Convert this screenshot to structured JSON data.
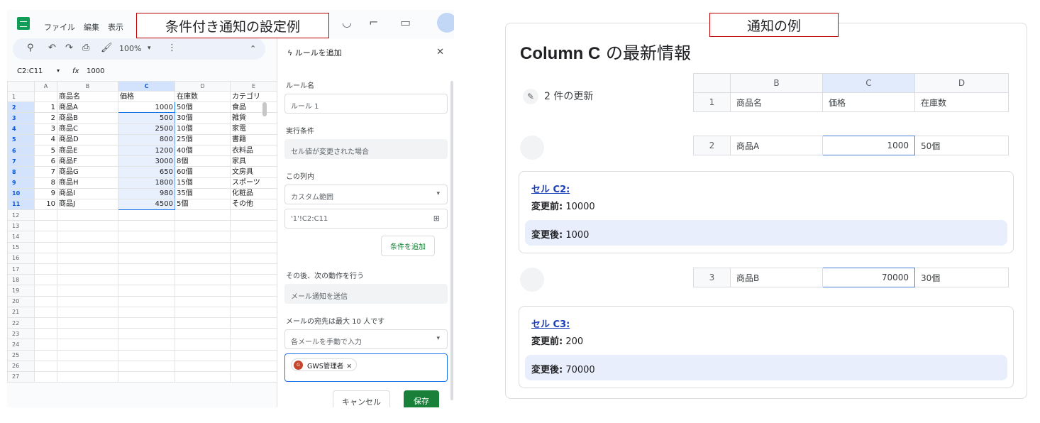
{
  "sheet": {
    "menu": [
      "ファイル",
      "編集",
      "表示"
    ],
    "callout": "条件付き通知の設定例",
    "toolbar": {
      "zoom": "100%"
    },
    "name_box": "C2:C11",
    "formula_icon": "fx",
    "formula_value": "1000",
    "columns": [
      "A",
      "B",
      "C",
      "D",
      "E"
    ],
    "selected_column": "C",
    "rows": [
      {
        "n": "1",
        "a": "",
        "b": "商品名",
        "c": "価格",
        "d": "在庫数",
        "e": "カテゴリ"
      },
      {
        "n": "2",
        "a": "1",
        "b": "商品A",
        "c": "1000",
        "d": "50個",
        "e": "食品"
      },
      {
        "n": "3",
        "a": "2",
        "b": "商品B",
        "c": "500",
        "d": "30個",
        "e": "雑貨"
      },
      {
        "n": "4",
        "a": "3",
        "b": "商品C",
        "c": "2500",
        "d": "10個",
        "e": "家電"
      },
      {
        "n": "5",
        "a": "4",
        "b": "商品D",
        "c": "800",
        "d": "25個",
        "e": "書籍"
      },
      {
        "n": "6",
        "a": "5",
        "b": "商品E",
        "c": "1200",
        "d": "40個",
        "e": "衣料品"
      },
      {
        "n": "7",
        "a": "6",
        "b": "商品F",
        "c": "3000",
        "d": "8個",
        "e": "家具"
      },
      {
        "n": "8",
        "a": "7",
        "b": "商品G",
        "c": "650",
        "d": "60個",
        "e": "文房具"
      },
      {
        "n": "9",
        "a": "8",
        "b": "商品H",
        "c": "1800",
        "d": "15個",
        "e": "スポーツ"
      },
      {
        "n": "10",
        "a": "9",
        "b": "商品I",
        "c": "980",
        "d": "35個",
        "e": "化粧品"
      },
      {
        "n": "11",
        "a": "10",
        "b": "商品J",
        "c": "4500",
        "d": "5個",
        "e": "その他"
      }
    ],
    "empty_rows": [
      "12",
      "13",
      "14",
      "15",
      "16",
      "17",
      "18",
      "19",
      "20",
      "21",
      "22",
      "23",
      "24",
      "25",
      "26",
      "27"
    ]
  },
  "rule_panel": {
    "title": "ルールを追加",
    "rule_name_label": "ルール名",
    "rule_name_value": "ルール 1",
    "trigger_label": "実行条件",
    "trigger_value": "セル値が変更された場合",
    "column_label": "この列内",
    "column_value": "カスタム範囲",
    "range_value": "'1'!C2:C11",
    "add_condition": "条件を追加",
    "action_label": "その後、次の動作を行う",
    "action_value": "メール通知を送信",
    "recipients_label": "メールの宛先は最大 10 人です",
    "recipients_mode": "各メールを手動で入力",
    "recipient_chip": "GWS管理者",
    "recipient_initial": "G",
    "cancel": "キャンセル",
    "save": "保存"
  },
  "notification": {
    "callout": "通知の例",
    "title_bold": "Column C",
    "title_rest": " の最新情報",
    "updates": "2 件の更新",
    "header": {
      "idx": "1",
      "b": "商品名",
      "c": "価格",
      "d": "在庫数",
      "col_b": "B",
      "col_c": "C",
      "col_d": "D"
    },
    "changes": [
      {
        "row": "2",
        "name": "商品A",
        "value": "1000",
        "stock": "50個",
        "cell_link": "セル C2:",
        "before_label": "変更前:",
        "before": "10000",
        "after_label": "変更後:",
        "after": "1000"
      },
      {
        "row": "3",
        "name": "商品B",
        "value": "70000",
        "stock": "30個",
        "cell_link": "セル C3:",
        "before_label": "変更前:",
        "before": "200",
        "after_label": "変更後:",
        "after": "70000"
      }
    ]
  },
  "colors": {
    "accent": "#1a73e8",
    "callout_border": "#c00000",
    "save_green": "#188038",
    "after_bg": "#e8eefc"
  }
}
